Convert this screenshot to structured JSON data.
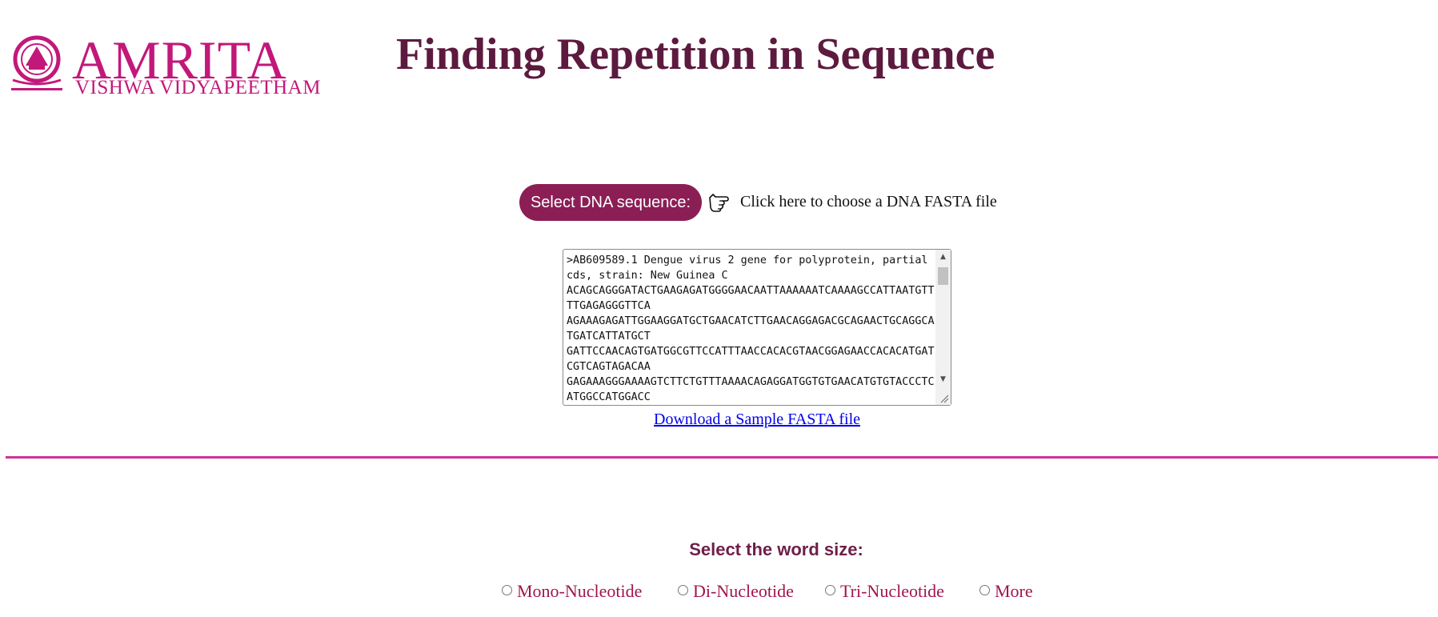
{
  "logo": {
    "wordmark": "AMRITA",
    "subtitle": "VISHWA VIDYAPEETHAM",
    "brand_color": "#c2187a"
  },
  "page_title": "Finding Repetition in Sequence",
  "file_select": {
    "button_label": "Select DNA sequence:",
    "chooser_icon": "pointing-hand-icon",
    "chooser_label": "Click here to choose a DNA FASTA file"
  },
  "sequence": {
    "value": ">AB609589.1 Dengue virus 2 gene for polyprotein, partial cds, strain: New Guinea C\nACAGCAGGGATACTGAAGAGATGGGGAACAATTAAAAAATCAAAAGCCATTAATGTTTTGAGAGGGTTCA\nAGAAAGAGATTGGAAGGATGCTGAACATCTTGAACAGGAGACGCAGAACTGCAGGCATGATCATTATGCT\nGATTCCAACAGTGATGGCGTTCCATTTAACCACACGTAACGGAGAACCACACATGATCGTCAGTAGACAA\nGAGAAAGGGAAAAGTCTTCTGTTTAAAACAGAGGATGGTGTGAACATGTGTACCCTCATGGCCATGGACC"
  },
  "download_link": "Download a Sample FASTA file",
  "word_size": {
    "label": "Select the word size:",
    "options": [
      "Mono-Nucleotide",
      "Di-Nucleotide",
      "Tri-Nucleotide",
      "More"
    ]
  },
  "colors": {
    "title": "#5c1a3e",
    "button_bg": "#8b1e55",
    "divider": "#cc3399",
    "radio_text": "#a0154e",
    "link": "#0000ee"
  }
}
